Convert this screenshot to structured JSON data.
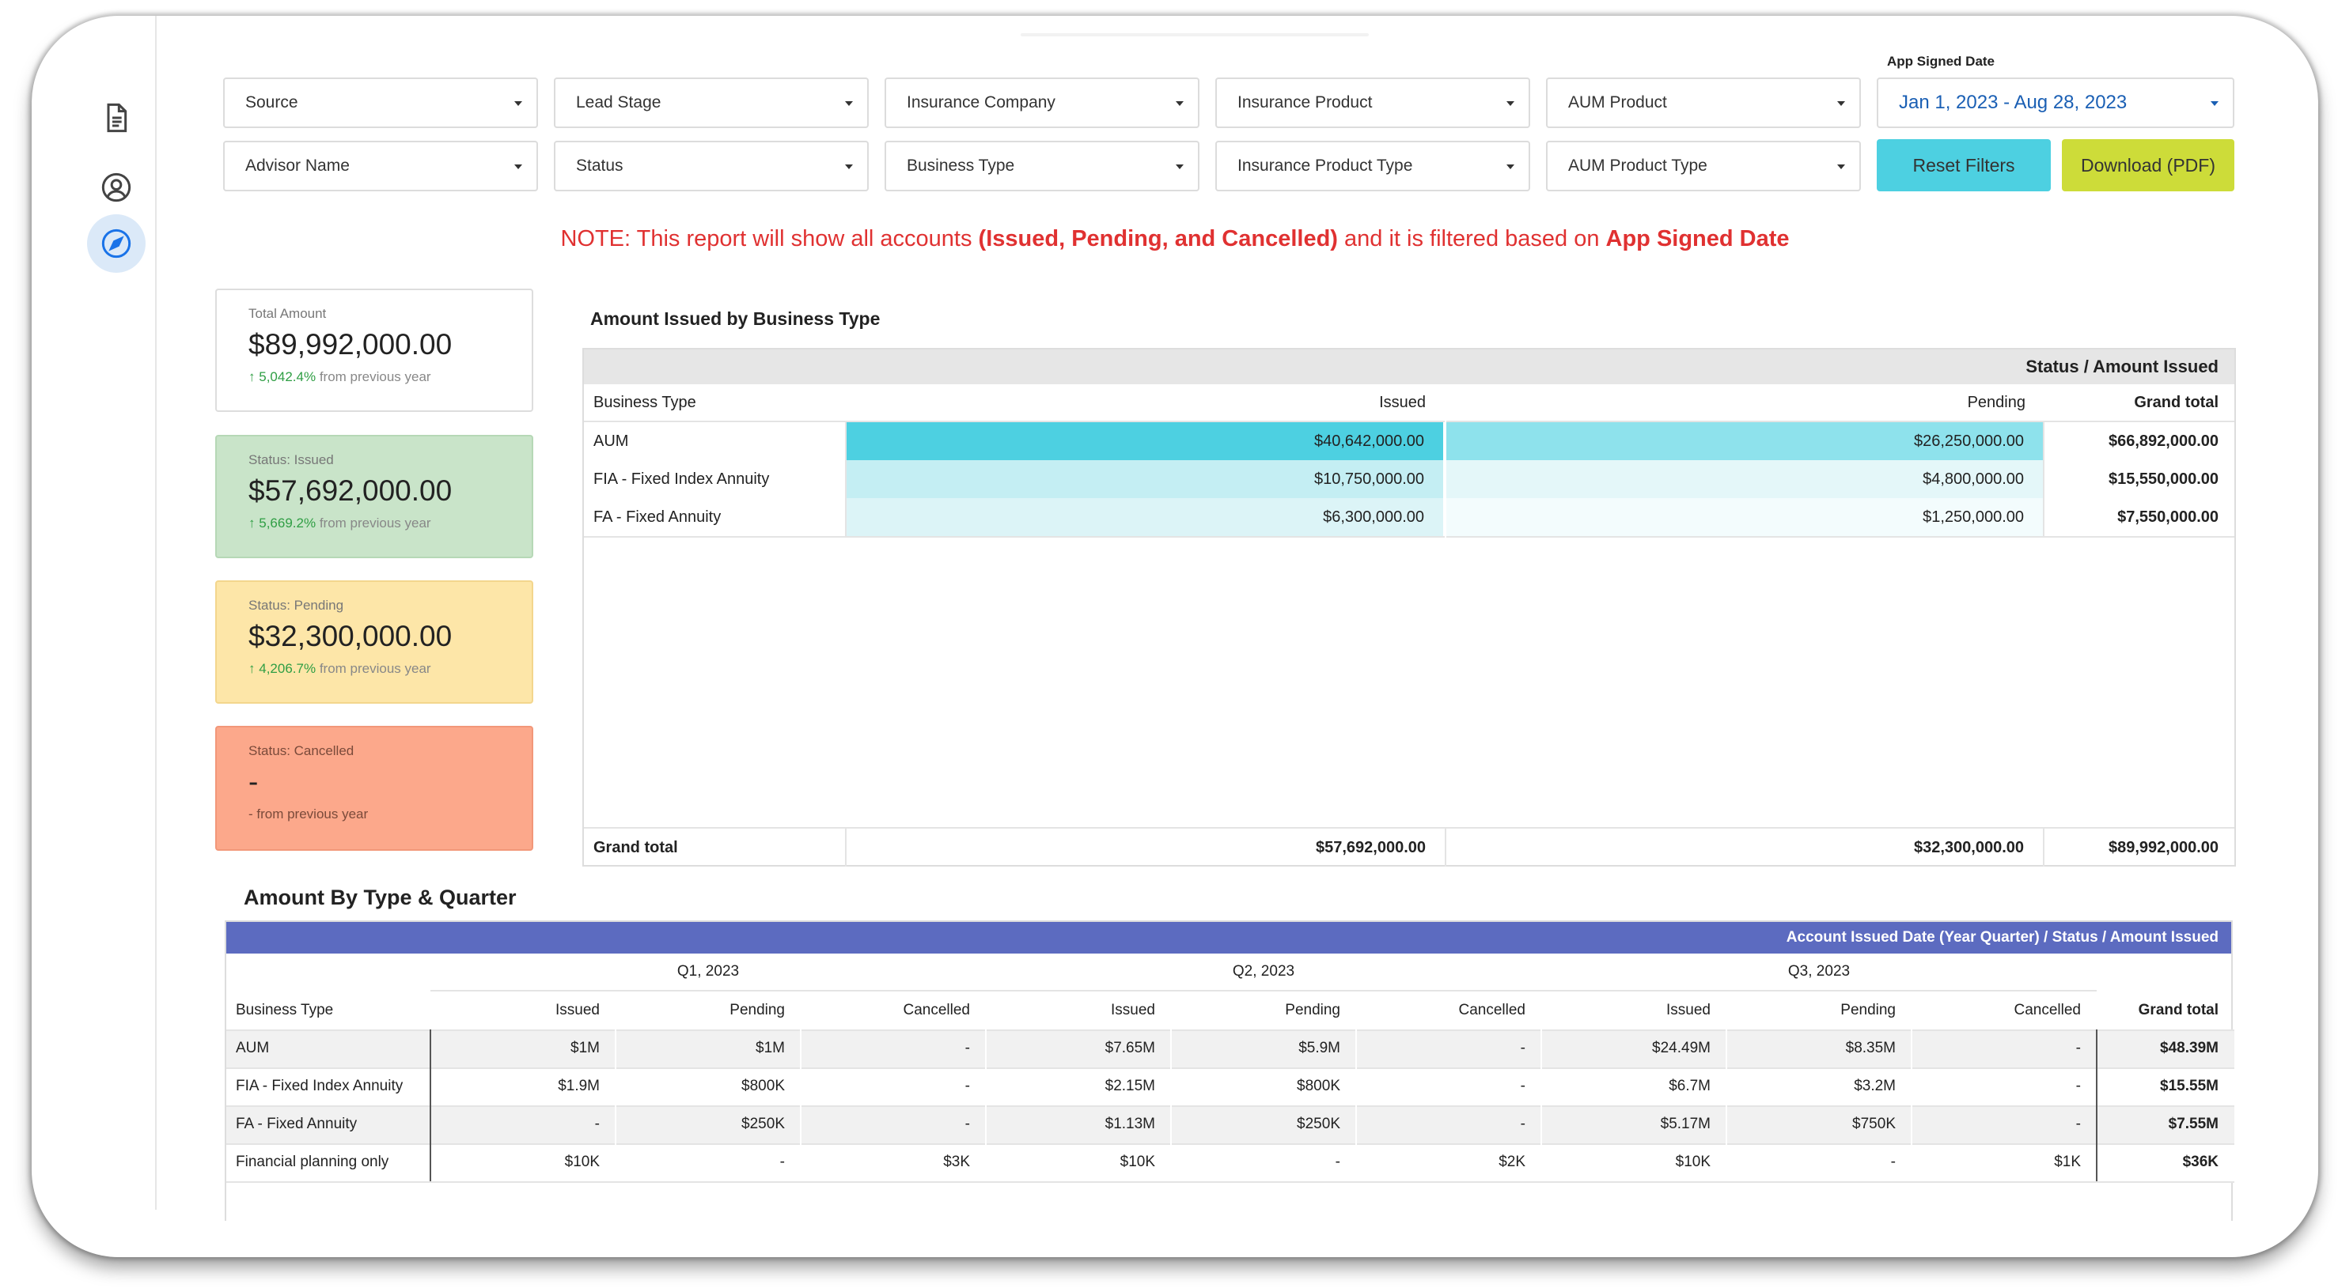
{
  "filters": {
    "row1": [
      "Source",
      "Lead Stage",
      "Insurance Company",
      "Insurance Product",
      "AUM Product"
    ],
    "row2": [
      "Advisor Name",
      "Status",
      "Business Type",
      "Insurance Product Type",
      "AUM Product Type"
    ],
    "date_label": "App Signed Date",
    "date_value": "Jan 1, 2023 - Aug 28, 2023",
    "reset_label": "Reset Filters",
    "download_label": "Download (PDF)"
  },
  "note": {
    "part1": "NOTE: This report will show all accounts ",
    "bold1": "(Issued, Pending, and Cancelled)",
    "part2": " and it is filtered based on ",
    "bold2": "App Signed Date"
  },
  "cards": [
    {
      "label": "Total Amount",
      "amount": "$89,992,000.00",
      "pct": "5,042.4%",
      "suffix": "from previous year",
      "bg": "#ffffff"
    },
    {
      "label": "Status: Issued",
      "amount": "$57,692,000.00",
      "pct": "5,669.2%",
      "suffix": "from previous year",
      "bg": "#c9e4c9"
    },
    {
      "label": "Status: Pending",
      "amount": "$32,300,000.00",
      "pct": "4,206.7%",
      "suffix": "from previous year",
      "bg": "#fde6a8"
    },
    {
      "label": "Status: Cancelled",
      "amount": "-",
      "pct": "",
      "suffix": "- from previous year",
      "bg": "#fca88b"
    }
  ],
  "business_table": {
    "title": "Amount Issued by Business Type",
    "super_header": "Status / Amount Issued",
    "headers": [
      "Business Type",
      "Issued",
      "Pending",
      "Grand total"
    ],
    "rows": [
      {
        "type": "AUM",
        "issued": "$40,642,000.00",
        "pending": "$26,250,000.00",
        "total": "$66,892,000.00",
        "issued_color": "#4dd0e1",
        "pending_color": "#8ee2ec"
      },
      {
        "type": "FIA - Fixed Index Annuity",
        "issued": "$10,750,000.00",
        "pending": "$4,800,000.00",
        "total": "$15,550,000.00",
        "issued_color": "#c4eef3",
        "pending_color": "#e4f7f9"
      },
      {
        "type": "FA - Fixed Annuity",
        "issued": "$6,300,000.00",
        "pending": "$1,250,000.00",
        "total": "$7,550,000.00",
        "issued_color": "#dcf4f7",
        "pending_color": "#f3fcfd"
      }
    ],
    "grand": {
      "label": "Grand total",
      "issued": "$57,692,000.00",
      "pending": "$32,300,000.00",
      "total": "$89,992,000.00"
    }
  },
  "quarter_table": {
    "title": "Amount By Type & Quarter",
    "band_header": "Account Issued Date (Year Quarter) / Status / Amount Issued",
    "quarters": [
      "Q1, 2023",
      "Q2, 2023",
      "Q3, 2023"
    ],
    "status_headers": [
      "Issued",
      "Pending",
      "Cancelled"
    ],
    "type_header": "Business Type",
    "total_header": "Grand total",
    "rows": [
      {
        "type": "AUM",
        "values": [
          "$1M",
          "$1M",
          "-",
          "$7.65M",
          "$5.9M",
          "-",
          "$24.49M",
          "$8.35M",
          "-"
        ],
        "total": "$48.39M"
      },
      {
        "type": "FIA - Fixed Index Annuity",
        "values": [
          "$1.9M",
          "$800K",
          "-",
          "$2.15M",
          "$800K",
          "-",
          "$6.7M",
          "$3.2M",
          "-"
        ],
        "total": "$15.55M"
      },
      {
        "type": "FA - Fixed Annuity",
        "values": [
          "-",
          "$250K",
          "-",
          "$1.13M",
          "$250K",
          "-",
          "$5.17M",
          "$750K",
          "-"
        ],
        "total": "$7.55M"
      },
      {
        "type": "Financial planning only",
        "values": [
          "$10K",
          "-",
          "$3K",
          "$10K",
          "-",
          "$2K",
          "$10K",
          "-",
          "$1K"
        ],
        "total": "$36K"
      }
    ]
  },
  "icons": [
    "document-icon",
    "user-circle-icon",
    "compass-icon"
  ],
  "colors": {
    "accent_blue": "#1a5fb4",
    "reset_bg": "#4dd0e1",
    "download_bg": "#cddc39",
    "note_red": "#e03131",
    "band_purple": "#5c6bc0"
  }
}
